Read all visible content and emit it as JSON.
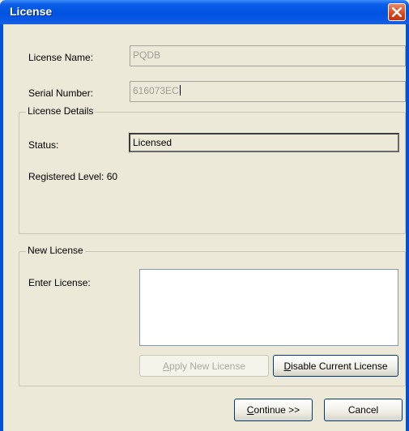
{
  "window": {
    "title": "License"
  },
  "license_name": {
    "label": "License Name:",
    "value": "PQDB"
  },
  "serial_number": {
    "label": "Serial Number:",
    "value": "616073EC"
  },
  "license_details": {
    "legend": "License Details",
    "status_label": "Status:",
    "status_value": "Licensed",
    "registered_level": "Registered Level: 60"
  },
  "new_license": {
    "legend": "New License",
    "enter_label": "Enter License:",
    "enter_value": "",
    "apply_button": {
      "mnemonic": "A",
      "rest": "pply New License",
      "enabled": false
    },
    "disable_button": {
      "mnemonic": "D",
      "rest": "isable Current License",
      "enabled": true
    }
  },
  "footer": {
    "continue_button": {
      "mnemonic": "C",
      "rest": "ontinue >>"
    },
    "cancel_button": {
      "label": "Cancel"
    }
  },
  "colors": {
    "titlebar": "#0052e0",
    "dialog_bg": "#ece9d8",
    "close_button": "#d9461e"
  },
  "icons": {
    "close": "close-icon"
  }
}
